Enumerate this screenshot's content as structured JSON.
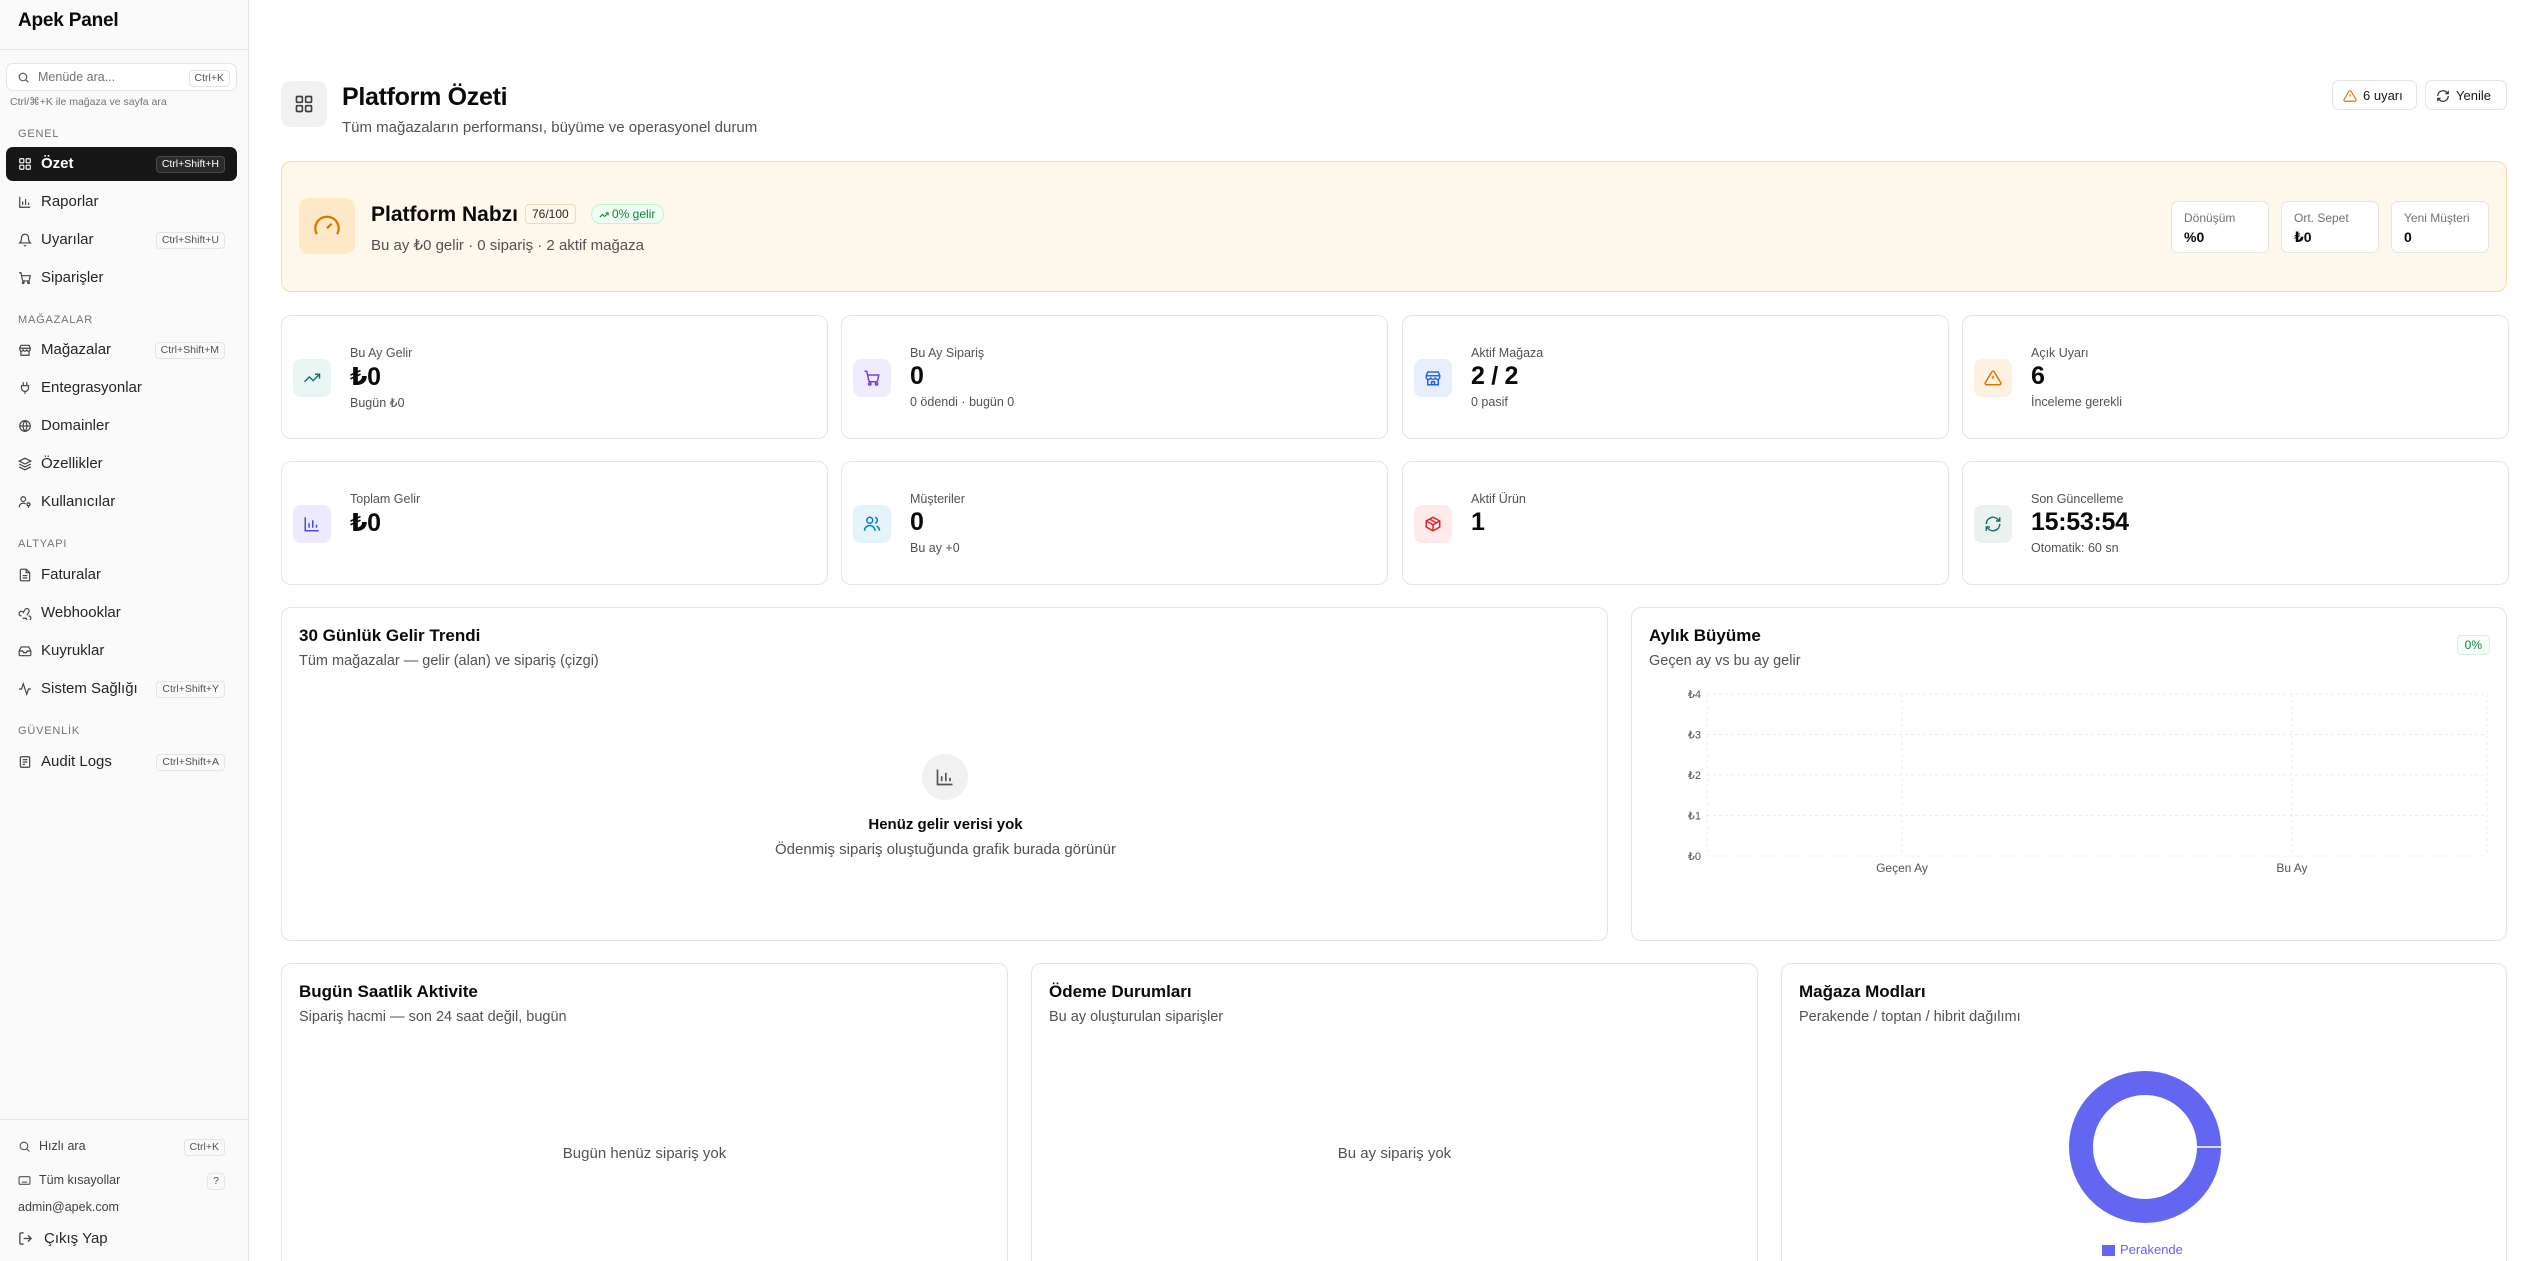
{
  "app": {
    "brand": "Apek Panel",
    "search_placeholder": "Menüde ara...",
    "search_kbd": "Ctrl+K",
    "search_hint": "Ctrl/⌘+K ile mağaza ve sayfa ara"
  },
  "sidebar": {
    "groups": [
      {
        "label": "GENEL",
        "items": [
          {
            "label": "Özet",
            "kbd": "Ctrl+Shift+H",
            "icon": "grid-icon",
            "active": true
          },
          {
            "label": "Raporlar",
            "kbd": "",
            "icon": "bar-chart-icon"
          },
          {
            "label": "Uyarılar",
            "kbd": "Ctrl+Shift+U",
            "icon": "bell-icon"
          },
          {
            "label": "Siparişler",
            "kbd": "",
            "icon": "cart-icon"
          }
        ]
      },
      {
        "label": "MAĞAZALAR",
        "items": [
          {
            "label": "Mağazalar",
            "kbd": "Ctrl+Shift+M",
            "icon": "store-icon"
          },
          {
            "label": "Entegrasyonlar",
            "kbd": "",
            "icon": "plug-icon"
          },
          {
            "label": "Domainler",
            "kbd": "",
            "icon": "globe-icon"
          },
          {
            "label": "Özellikler",
            "kbd": "",
            "icon": "layers-icon"
          },
          {
            "label": "Kullanıcılar",
            "kbd": "",
            "icon": "user-key-icon"
          }
        ]
      },
      {
        "label": "ALTYAPI",
        "items": [
          {
            "label": "Faturalar",
            "kbd": "",
            "icon": "file-icon"
          },
          {
            "label": "Webhooklar",
            "kbd": "",
            "icon": "webhook-icon"
          },
          {
            "label": "Kuyruklar",
            "kbd": "",
            "icon": "inbox-icon"
          },
          {
            "label": "Sistem Sağlığı",
            "kbd": "Ctrl+Shift+Y",
            "icon": "activity-icon"
          }
        ]
      },
      {
        "label": "GÜVENLİK",
        "items": [
          {
            "label": "Audit Logs",
            "kbd": "Ctrl+Shift+A",
            "icon": "log-icon"
          }
        ]
      }
    ],
    "footer": {
      "quick_search": "Hızlı ara",
      "quick_search_kbd": "Ctrl+K",
      "shortcuts": "Tüm kısayollar",
      "shortcuts_kbd": "?",
      "email": "admin@apek.com",
      "logout": "Çıkış Yap"
    }
  },
  "header": {
    "title": "Platform Özeti",
    "subtitle": "Tüm mağazaların performansı, büyüme ve operasyonel durum",
    "alerts_button": "6 uyarı",
    "refresh_button": "Yenile"
  },
  "pulse": {
    "title": "Platform Nabzı",
    "score": "76/100",
    "growth": "0% gelir",
    "summary": "Bu ay ₺0 gelir · 0 sipariş · 2 aktif mağaza",
    "minis": [
      {
        "label": "Dönüşüm",
        "value": "%0"
      },
      {
        "label": "Ort. Sepet",
        "value": "₺0"
      },
      {
        "label": "Yeni Müşteri",
        "value": "0"
      }
    ]
  },
  "stats": [
    {
      "label": "Bu Ay Gelir",
      "value": "₺0",
      "sub": "Bugün ₺0",
      "icon": "trending-up-icon",
      "color": "#0f766e",
      "bg": "#e8f5f2"
    },
    {
      "label": "Bu Ay Sipariş",
      "value": "0",
      "sub": "0 ödendi · bugün 0",
      "icon": "cart-icon",
      "color": "#7c3aed",
      "bg": "#f1ecfd"
    },
    {
      "label": "Aktif Mağaza",
      "value": "2 / 2",
      "sub": "0 pasif",
      "icon": "store-icon",
      "color": "#2563eb",
      "bg": "#e8effc"
    },
    {
      "label": "Açık Uyarı",
      "value": "6",
      "sub": "İnceleme gerekli",
      "icon": "warning-icon",
      "color": "#d97706",
      "bg": "#fdf1e1"
    },
    {
      "label": "Toplam Gelir",
      "value": "₺0",
      "sub": "",
      "icon": "bar-chart-icon",
      "color": "#4f46e5",
      "bg": "#ecebfd"
    },
    {
      "label": "Müşteriler",
      "value": "0",
      "sub": "Bu ay +0",
      "icon": "users-icon",
      "color": "#0284c7",
      "bg": "#e5f3fb"
    },
    {
      "label": "Aktif Ürün",
      "value": "1",
      "sub": "",
      "icon": "box-icon",
      "color": "#dc2626",
      "bg": "#fdeaea"
    },
    {
      "label": "Son Güncelleme",
      "value": "15:53:54",
      "sub": "Otomatik: 60 sn",
      "icon": "refresh-icon",
      "color": "#0f766e",
      "bg": "#eaf1ef"
    }
  ],
  "trend": {
    "title": "30 Günlük Gelir Trendi",
    "subtitle": "Tüm mağazalar — gelir (alan) ve sipariş (çizgi)",
    "empty_title": "Henüz gelir verisi yok",
    "empty_sub": "Ödenmiş sipariş oluştuğunda grafik burada görünür"
  },
  "growth": {
    "title": "Aylık Büyüme",
    "subtitle": "Geçen ay vs bu ay gelir",
    "badge": "0%"
  },
  "hourly": {
    "title": "Bugün Saatlik Aktivite",
    "subtitle": "Sipariş hacmi — son 24 saat değil, bugün",
    "empty": "Bugün henüz sipariş yok"
  },
  "payments": {
    "title": "Ödeme Durumları",
    "subtitle": "Bu ay oluşturulan siparişler",
    "empty": "Bu ay sipariş yok"
  },
  "modes": {
    "title": "Mağaza Modları",
    "subtitle": "Perakende / toptan / hibrit dağılımı"
  },
  "chart_data": [
    {
      "type": "bar",
      "title": "Aylık Büyüme",
      "categories": [
        "Geçen Ay",
        "Bu Ay"
      ],
      "values": [
        0,
        0
      ],
      "yticks": [
        "₺0",
        "₺1",
        "₺2",
        "₺3",
        "₺4"
      ],
      "ylim": [
        0,
        4
      ],
      "grid": true
    },
    {
      "type": "pie",
      "title": "Mağaza Modları",
      "categories": [
        "Perakende"
      ],
      "values": [
        1
      ],
      "colors": [
        "#6366f1"
      ],
      "donut": true
    }
  ]
}
